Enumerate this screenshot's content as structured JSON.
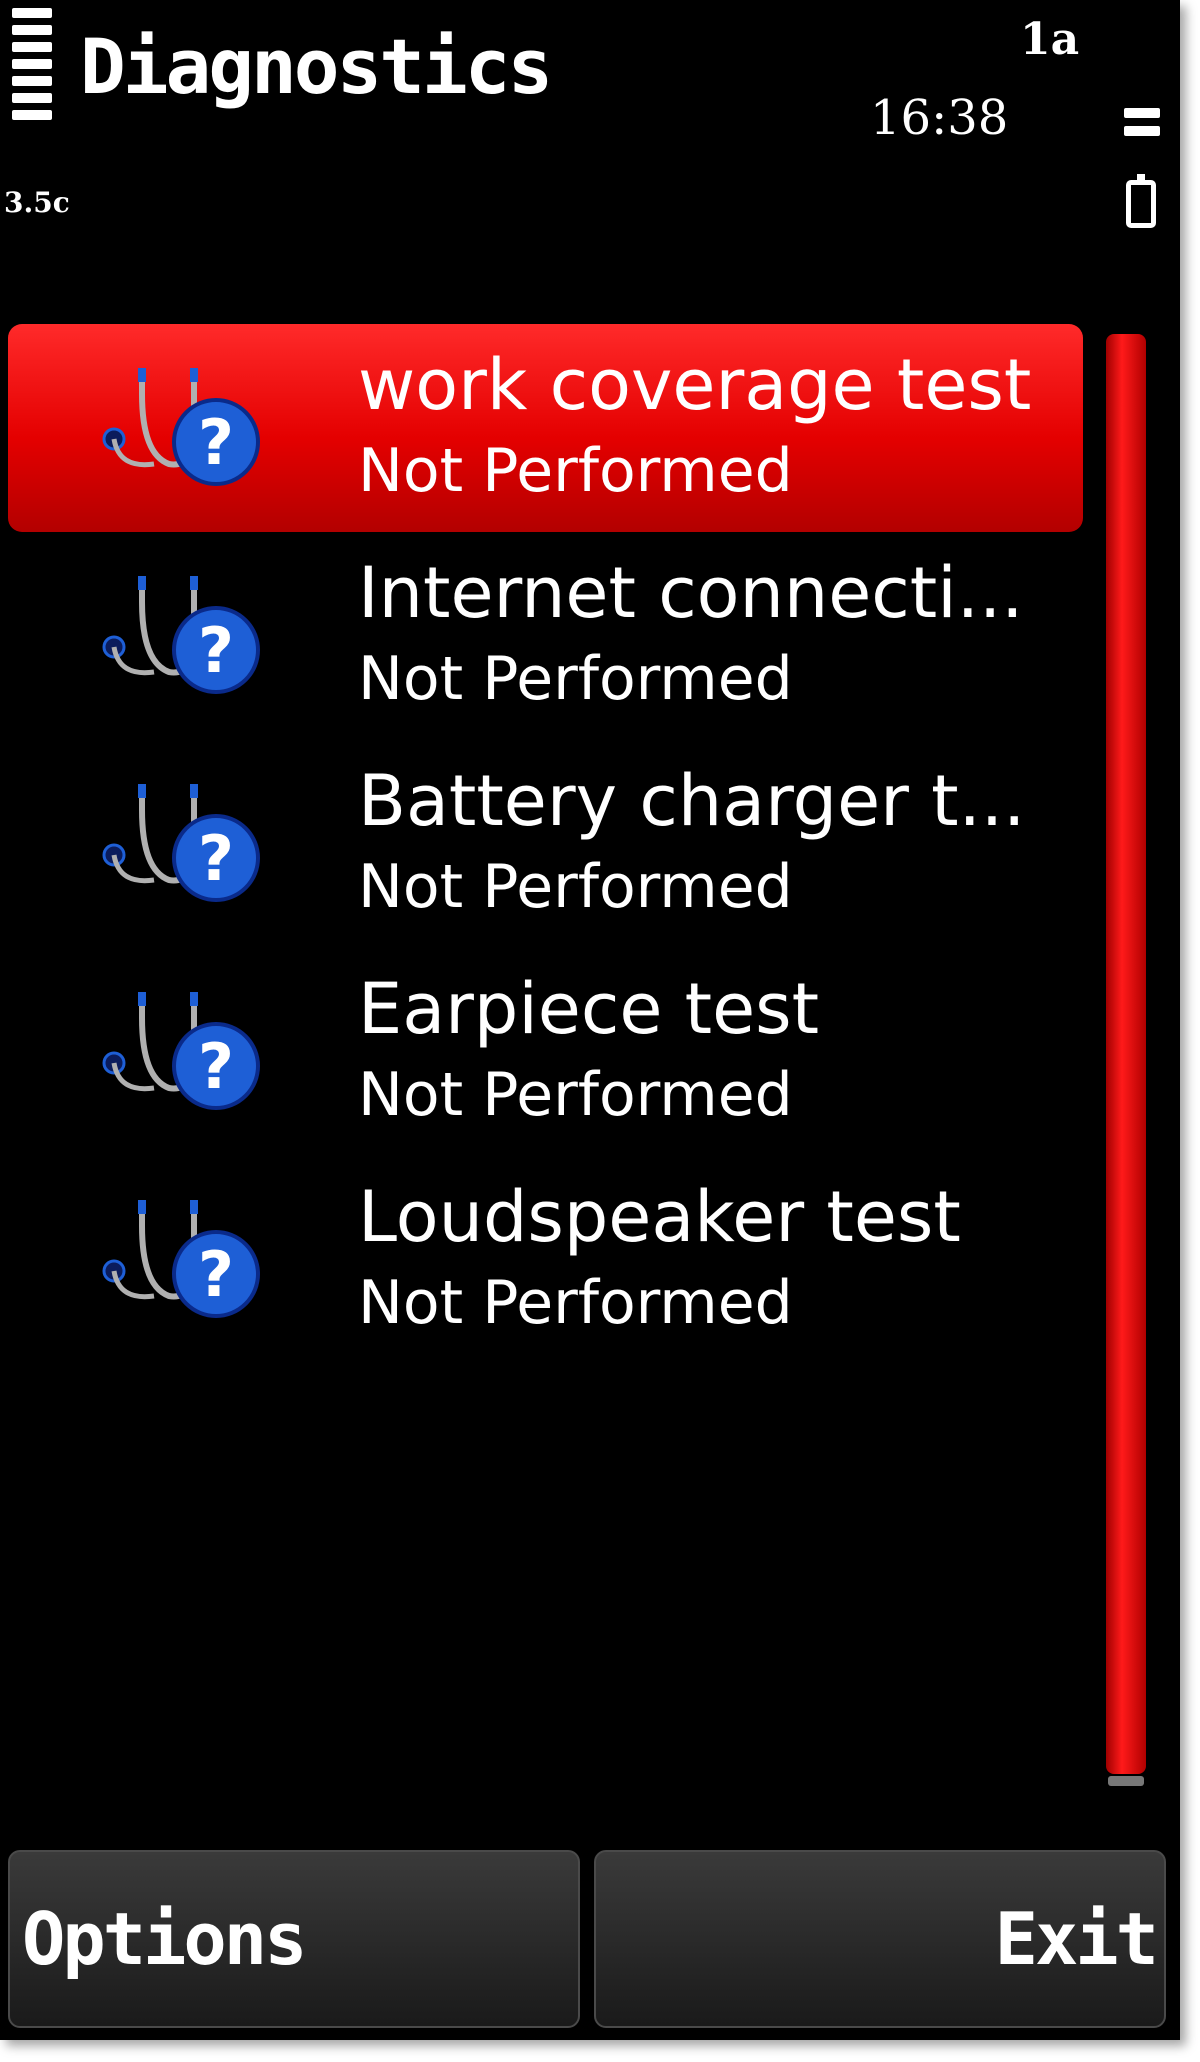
{
  "status": {
    "title": "Diagnostics",
    "signal_label": "3.5c",
    "network_indicator": "1a",
    "time": "16:38"
  },
  "list": {
    "items": [
      {
        "title": "work coverage test",
        "status": "Not Performed",
        "selected": true
      },
      {
        "title": "Internet connecti...",
        "status": "Not Performed",
        "selected": false
      },
      {
        "title": "Battery charger t...",
        "status": "Not Performed",
        "selected": false
      },
      {
        "title": "Earpiece test",
        "status": "Not Performed",
        "selected": false
      },
      {
        "title": "Loudspeaker test",
        "status": "Not Performed",
        "selected": false
      }
    ],
    "icon": "stethoscope-question-icon"
  },
  "softkeys": {
    "left": "Options",
    "right": "Exit"
  },
  "colors": {
    "highlight": "#e40000",
    "background": "#000000",
    "icon_blue": "#1e5fd6"
  }
}
